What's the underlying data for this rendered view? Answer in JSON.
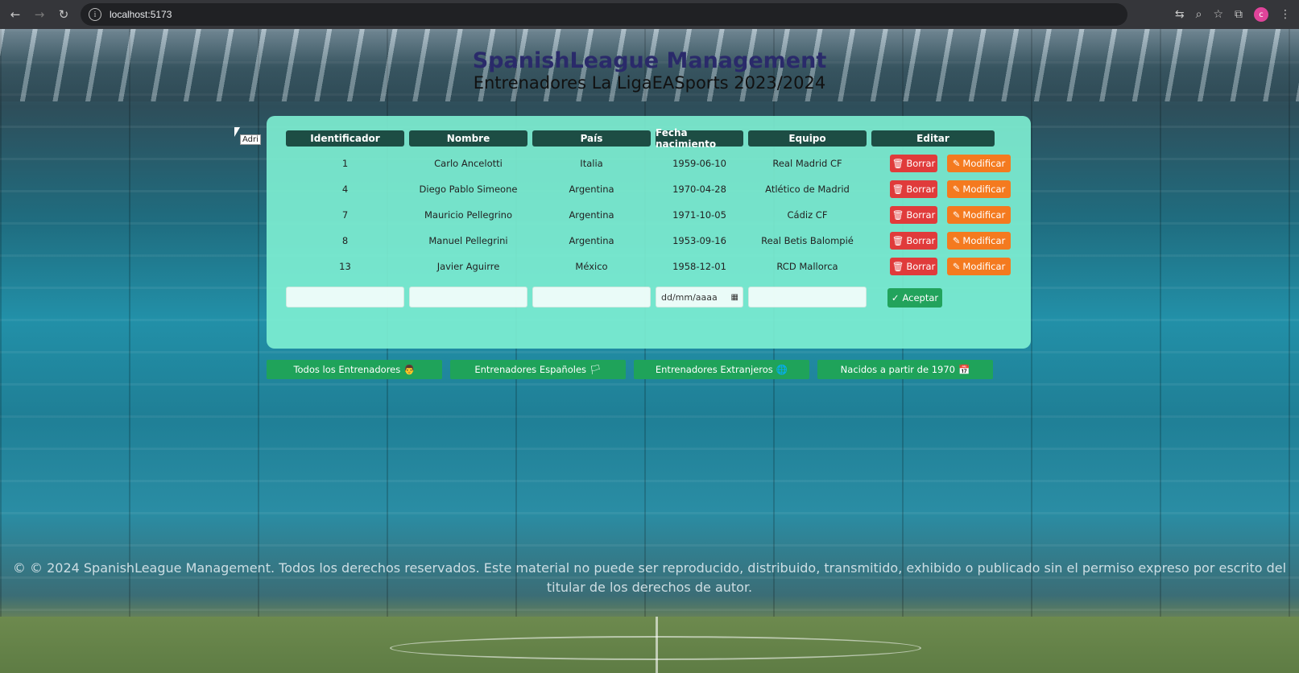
{
  "browser": {
    "url": "localhost:5173"
  },
  "page": {
    "title": "SpanishLeague Management",
    "subtitle": "Entrenadores La LigaEASports 2023/2024",
    "tooltip": "Adri"
  },
  "table": {
    "headers": [
      "Identificador",
      "Nombre",
      "País",
      "Fecha nacimiento",
      "Equipo",
      "Editar"
    ],
    "rows": [
      {
        "id": "1",
        "nombre": "Carlo Ancelotti",
        "pais": "Italia",
        "fecha": "1959-06-10",
        "equipo": "Real Madrid CF"
      },
      {
        "id": "4",
        "nombre": "Diego Pablo Simeone",
        "pais": "Argentina",
        "fecha": "1970-04-28",
        "equipo": "Atlético de Madrid"
      },
      {
        "id": "7",
        "nombre": "Mauricio Pellegrino",
        "pais": "Argentina",
        "fecha": "1971-10-05",
        "equipo": "Cádiz CF"
      },
      {
        "id": "8",
        "nombre": "Manuel Pellegrini",
        "pais": "Argentina",
        "fecha": "1953-09-16",
        "equipo": "Real Betis Balompié"
      },
      {
        "id": "13",
        "nombre": "Javier Aguirre",
        "pais": "México",
        "fecha": "1958-12-01",
        "equipo": "RCD Mallorca"
      }
    ],
    "delete_label": "Borrar",
    "edit_label": "Modificar"
  },
  "form": {
    "date_placeholder": "dd/mm/aaaa",
    "accept_label": "Aceptar"
  },
  "filters": [
    {
      "label": "Todos los Entrenadores",
      "icon": "👨"
    },
    {
      "label": "Entrenadores Españoles",
      "icon": "🏳"
    },
    {
      "label": "Entrenadores Extranjeros",
      "icon": "🌐"
    },
    {
      "label": "Nacidos a partir de 1970",
      "icon": "📅"
    }
  ],
  "footer": {
    "text": "© © 2024 SpanishLeague Management. Todos los derechos reservados. Este material no puede ser reproducido, distribuido, transmitido, exhibido o publicado sin el permiso expreso por escrito del titular de los derechos de autor."
  }
}
